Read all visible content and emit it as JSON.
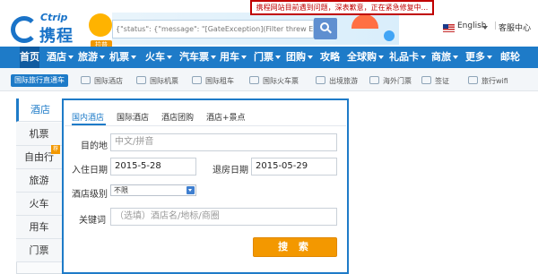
{
  "alert": {
    "text": "携程网站目前遇到问题，深表歉意，正在紧急修复中..."
  },
  "header": {
    "logo_en": "Ctrip",
    "logo_cn": "携程",
    "logo_badge": "拉普",
    "search_text": "{\"status\": {\"message\": \"[GateException](Filter threw Except",
    "language": "English",
    "service": "客服中心"
  },
  "nav": {
    "items": [
      {
        "label": "首页",
        "caret": false
      },
      {
        "label": "酒店",
        "caret": true
      },
      {
        "label": "旅游",
        "caret": true
      },
      {
        "label": "机票",
        "caret": true
      },
      {
        "label": "火车",
        "caret": true
      },
      {
        "label": "汽车票",
        "caret": true
      },
      {
        "label": "用车",
        "caret": true
      },
      {
        "label": "门票",
        "caret": true
      },
      {
        "label": "团购",
        "caret": true
      },
      {
        "label": "攻略",
        "caret": false
      },
      {
        "label": "全球购",
        "caret": true
      },
      {
        "label": "礼品卡",
        "caret": true
      },
      {
        "label": "商旅",
        "caret": true
      },
      {
        "label": "更多",
        "caret": true
      },
      {
        "label": "邮轮",
        "caret": false
      }
    ]
  },
  "subnav": {
    "tag": "国际旅行直通车",
    "items": [
      {
        "label": "国际酒店",
        "icon": "hotel-icon"
      },
      {
        "label": "国际机票",
        "icon": "plane-icon"
      },
      {
        "label": "国际租车",
        "icon": "car-icon"
      },
      {
        "label": "国际火车票",
        "icon": "train-icon"
      },
      {
        "label": "出境旅游",
        "icon": "travel-icon"
      },
      {
        "label": "海外门票",
        "icon": "ticket-icon"
      },
      {
        "label": "签证",
        "icon": "visa-icon"
      },
      {
        "label": "旅行wifi",
        "icon": "wifi-icon"
      }
    ]
  },
  "side_tabs": {
    "items": [
      {
        "label": "酒店"
      },
      {
        "label": "机票"
      },
      {
        "label": "自由行"
      },
      {
        "label": "旅游"
      },
      {
        "label": "火车"
      },
      {
        "label": "用车"
      },
      {
        "label": "门票"
      }
    ],
    "badge": "荐"
  },
  "booking": {
    "tabs": [
      {
        "label": "国内酒店"
      },
      {
        "label": "国际酒店"
      },
      {
        "label": "酒店团购"
      },
      {
        "label": "酒店+景点"
      }
    ],
    "destination_label": "目的地",
    "destination_placeholder": "中文/拼音",
    "checkin_label": "入住日期",
    "checkin_value": "2015-5-28",
    "checkout_label": "退房日期",
    "checkout_value": "2015-05-29",
    "level_label": "酒店级别",
    "level_value": "不限",
    "keyword_label": "关键词",
    "keyword_placeholder": "（选填）酒店名/地标/商圈",
    "search_button": "搜 索"
  }
}
